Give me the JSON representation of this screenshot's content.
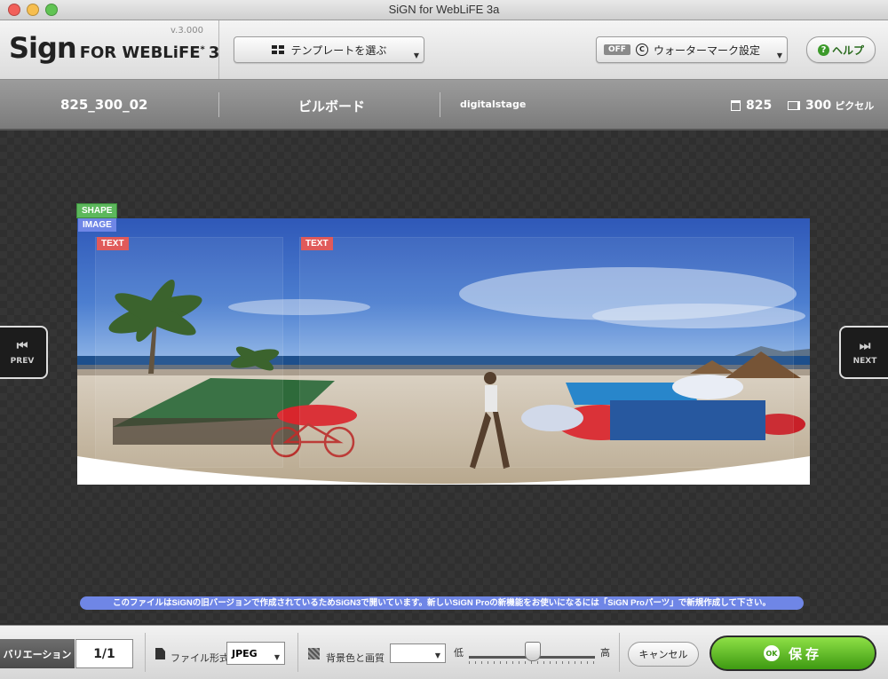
{
  "window": {
    "title": "SiGN for WebLiFE 3a"
  },
  "toolbar": {
    "logo_main": "Sign",
    "logo_rest": "FOR WEBLiFE",
    "logo_num": "3",
    "version": "v.3.000",
    "template_label": "テンプレートを選ぶ",
    "watermark_state": "OFF",
    "watermark_label": "ウォーターマーク設定",
    "help_label": "ヘルプ"
  },
  "info": {
    "name": "825_300_02",
    "category": "ビルボード",
    "author": "digitalstage",
    "width": "825",
    "height": "300",
    "unit": "ピクセル"
  },
  "canvas": {
    "tags": {
      "shape": "SHAPE",
      "image": "IMAGE",
      "text1": "TEXT",
      "text2": "TEXT"
    },
    "prev_label": "PREV",
    "next_label": "NEXT",
    "notice": "このファイルはSiGNの旧バージョンで作成されているためSiGN3で開いています。新しいSiGN Proの新機能をお使いになるには「SiGN Proパーツ」で新規作成して下さい。"
  },
  "bottom": {
    "variation_label": "バリエーション",
    "variation_value": "1/1",
    "format_label": "ファイル形式",
    "format_value": "JPEG",
    "bg_label": "背景色と画質",
    "quality_low": "低",
    "quality_high": "高",
    "quality_level": 0.5,
    "cancel_label": "キャンセル",
    "save_ok": "OK",
    "save_label": "保存"
  }
}
